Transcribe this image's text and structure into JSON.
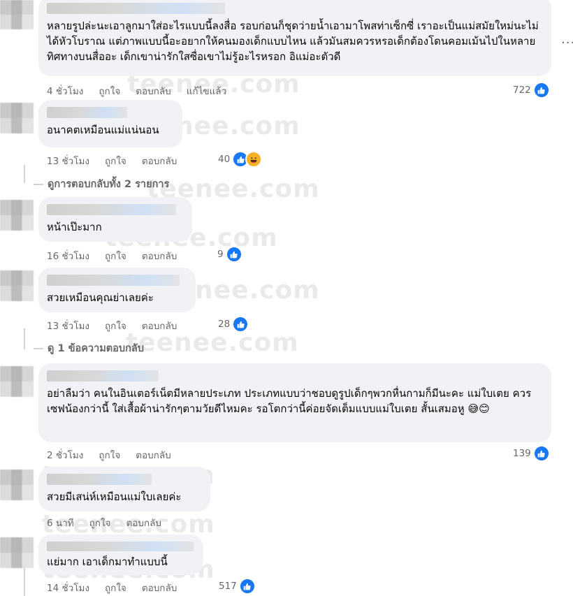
{
  "comments": [
    {
      "text": "หลายรูปล่ะนะเอาลูกมาใส่อะไรแบบนี้ลงสื่อ รอบก่อนก็ชุดว่ายน้ำเอามาโพสท่าเซ็กซี่ เราอะเป็นแม่สมัยใหม่นะไม่ได้หัวโบราณ แต่ภาพแบบนี้อะอยากให้คนมองเด็กแบบไหน แล้วมันสมควรหรอเด็กต้องโดนคอมเม้นไปในหลายทิศทางบนสื่ออะ เด็กเขาน่ารักใสซื่อเขาไม่รู้อะไรหรอก อิแม่อะตัวดี",
      "time": "4 ชั่วโมง",
      "like": "ถูกใจ",
      "reply": "ตอบกลับ",
      "edited": "แก้ไขแล้ว",
      "reactions": "722"
    },
    {
      "text": "อนาคตเหมือนแม่แน่นอน",
      "time": "13 ชั่วโมง",
      "like": "ถูกใจ",
      "reply": "ตอบกลับ",
      "reactions": "40"
    },
    {
      "text": "หน้าเป๊ะมาก",
      "time": "16 ชั่วโมง",
      "like": "ถูกใจ",
      "reply": "ตอบกลับ",
      "reactions": "9"
    },
    {
      "text": "สวยเหมือนคุณย่าเลยค่ะ",
      "time": "13 ชั่วโมง",
      "like": "ถูกใจ",
      "reply": "ตอบกลับ",
      "reactions": "28"
    },
    {
      "text": "อย่าลืมว่า คนในอินเตอร์เน็ตมีหลายประเภท ประเภทแบบว่าชอบดูรูปเด็กๆพวกหื่นกามก็มีนะคะ แม่ใบเตย ควรเซฟน้องกว่านี้ ใส่เสื้อผ้าน่ารักๆตามวัยดีไหมคะ รอโตกว่านี้ค่อยจัดเต็มแบบแม่ใบเตย สั้นเสมอหู",
      "emoji": "😅😊",
      "time": "2 ชั่วโมง",
      "like": "ถูกใจ",
      "reply": "ตอบกลับ",
      "reactions": "139"
    },
    {
      "text": "สวยมีเสน่ห์เหมือนแม่ใบเลยค่ะ",
      "time": "6 นาที",
      "like": "ถูกใจ",
      "reply": "ตอบกลับ"
    },
    {
      "text": "แย่มาก เอาเด็กมาทำแบบนี้",
      "time": "14 ชั่วโมง",
      "like": "ถูกใจ",
      "reply": "ตอบกลับ",
      "reactions": "517"
    }
  ],
  "replies_links": {
    "first": "ดูการตอบกลับทั้ง 2 รายการ",
    "second": "ดู 1 ข้อความตอบกลับ"
  },
  "more_menu": "...",
  "watermark": "teenee.com",
  "icons": {
    "like": "like-icon",
    "haha": "haha-icon",
    "more": "more-options-icon"
  },
  "colors": {
    "bubble": "#f0f2f5",
    "meta_text": "#65676b",
    "like_blue": "#1877f2"
  }
}
